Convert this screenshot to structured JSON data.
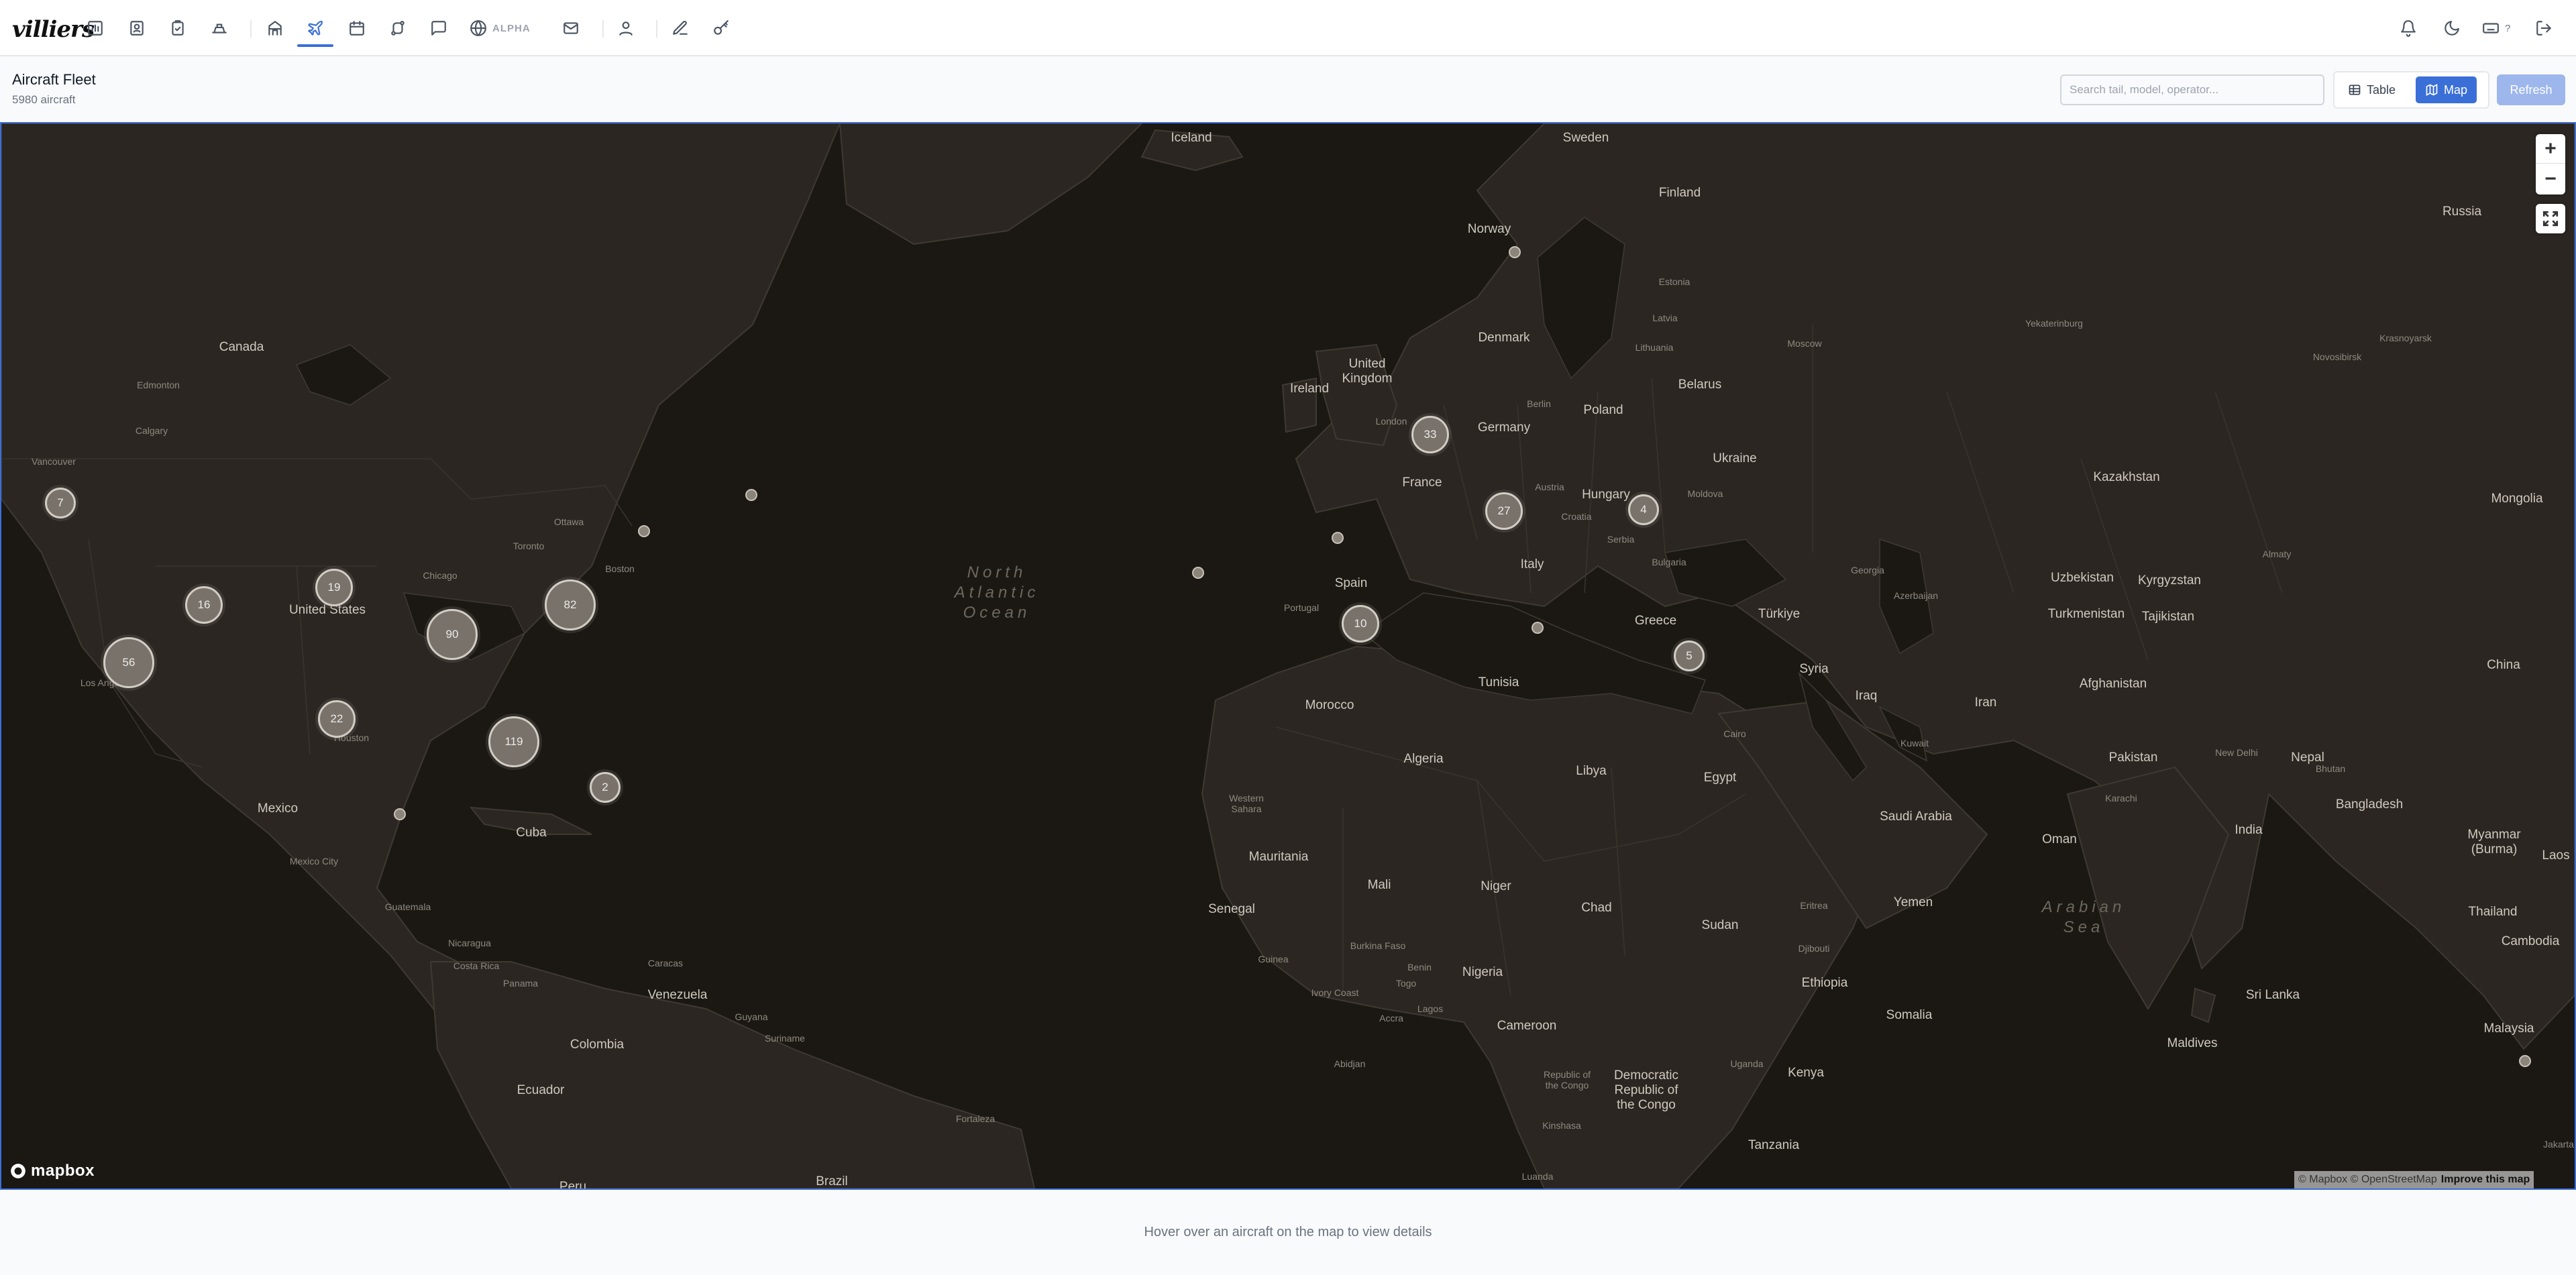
{
  "nav": {
    "logo": "villiers",
    "alpha_label": "ALPHA",
    "keyboard_count": "?",
    "icons": [
      "bar-chart",
      "contacts",
      "clipboard-check",
      "fleet",
      "building",
      "plane",
      "calendar",
      "route",
      "chat",
      "globe",
      "mail",
      "users",
      "edit",
      "key",
      "bell",
      "moon",
      "keyboard",
      "logout"
    ]
  },
  "header": {
    "title": "Aircraft Fleet",
    "subtitle": "5980 aircraft"
  },
  "search": {
    "placeholder": "Search tail, model, operator..."
  },
  "view_toggle": {
    "table_label": "Table",
    "map_label": "Map",
    "active": "Map"
  },
  "refresh_label": "Refresh",
  "map": {
    "zoom_in": "+",
    "zoom_out": "−",
    "logo_text": "mapbox",
    "attribution": "© Mapbox © OpenStreetMap",
    "improve_link": "Improve this map",
    "ocean_labels": {
      "north_atlantic": "North\nAtlantic\nOcean",
      "arabian_sea": "Arabian\nSea"
    },
    "country_labels": [
      "Iceland",
      "Sweden",
      "Finland",
      "Norway",
      "Russia",
      "Estonia",
      "Latvia",
      "Denmark",
      "Lithuania",
      "United Kingdom",
      "Ireland",
      "Belarus",
      "Poland",
      "Germany",
      "Ukraine",
      "Canada",
      "France",
      "Austria",
      "Hungary",
      "Moldova",
      "Kazakhstan",
      "Mongolia",
      "Croatia",
      "Serbia",
      "Bulgaria",
      "Italy",
      "Georgia",
      "Uzbekistan",
      "Kyrgyzstan",
      "Azerbaijan",
      "Spain",
      "Portugal",
      "United States",
      "Greece",
      "Turkmenistan",
      "Tajikistan",
      "Türkiye",
      "Syria",
      "Tunisia",
      "Iraq",
      "Iran",
      "Afghanistan",
      "Morocco",
      "China",
      "Algeria",
      "Libya",
      "Egypt",
      "Pakistan",
      "Nepal",
      "Bhutan",
      "Mexico",
      "Cuba",
      "Western Sahara",
      "Saudi Arabia",
      "Oman",
      "Bangladesh",
      "India",
      "Myanmar (Burma)",
      "Laos",
      "Mauritania",
      "Mali",
      "Niger",
      "Chad",
      "Sudan",
      "Eritrea",
      "Yemen",
      "Thailand",
      "Cambodia",
      "Guatemala",
      "Senegal",
      "Djibouti",
      "Nicaragua",
      "Burkina Faso",
      "Guinea",
      "Benin",
      "Togo",
      "Nigeria",
      "Ethiopia",
      "Costa Rica",
      "Venezuela",
      "Ivory Coast",
      "Somalia",
      "Sri Lanka",
      "Guyana",
      "Suriname",
      "Cameroon",
      "Colombia",
      "Maldives",
      "Malaysia",
      "Republic of the Congo",
      "Democratic Republic of the Congo",
      "Uganda",
      "Kenya",
      "Ecuador",
      "Tanzania",
      "Brazil",
      "Peru"
    ],
    "city_labels": [
      "Yekaterinburg",
      "Moscow",
      "Novosibirsk",
      "Krasnoyarsk",
      "Edmonton",
      "Calgary",
      "Vancouver",
      "London",
      "Berlin",
      "Ottawa",
      "Toronto",
      "Chicago",
      "Boston",
      "Almaty",
      "Los Angeles",
      "Houston",
      "Cairo",
      "Kuwait",
      "New Delhi",
      "Karachi",
      "Mexico City",
      "Caracas",
      "Panama",
      "Lagos",
      "Abidjan",
      "Accra",
      "Kinshasa",
      "Luanda",
      "Fortaleza",
      "Jakarta"
    ],
    "clusters": [
      {
        "count": "7",
        "region": "Vancouver"
      },
      {
        "count": "16",
        "region": "Western US"
      },
      {
        "count": "19",
        "region": "Central US"
      },
      {
        "count": "56",
        "region": "Los Angeles"
      },
      {
        "count": "90",
        "region": "Midwest US"
      },
      {
        "count": "82",
        "region": "US East Coast"
      },
      {
        "count": "22",
        "region": "Houston"
      },
      {
        "count": "119",
        "region": "Florida"
      },
      {
        "count": "2",
        "region": "Caribbean"
      },
      {
        "count": "33",
        "region": "London"
      },
      {
        "count": "27",
        "region": "Switzerland"
      },
      {
        "count": "4",
        "region": "Romania"
      },
      {
        "count": "10",
        "region": "Southern Spain"
      },
      {
        "count": "5",
        "region": "Turkey"
      }
    ]
  },
  "footer": {
    "hint": "Hover over an aircraft on the map to view details"
  }
}
